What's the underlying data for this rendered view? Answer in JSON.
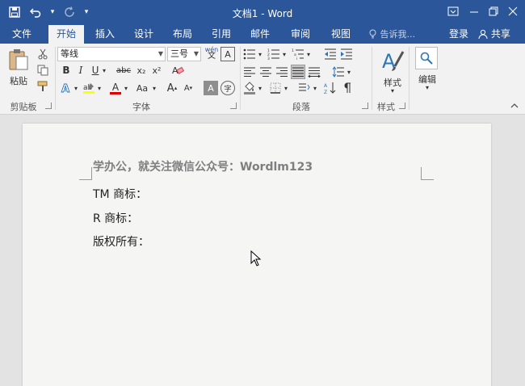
{
  "app": {
    "title": "文档1 - Word"
  },
  "tabs": [
    "文件",
    "开始",
    "插入",
    "设计",
    "布局",
    "引用",
    "邮件",
    "审阅",
    "视图"
  ],
  "tell_me": "告诉我...",
  "login": "登录",
  "share": "共享",
  "ribbon": {
    "paste_label": "粘贴",
    "clipboard_group": "剪贴板",
    "font_group": "字体",
    "paragraph_group": "段落",
    "styles_group": "样式",
    "styles_button": "样式",
    "edit_button": "编辑",
    "font_name": "等线",
    "font_size": "三号",
    "phonetic": "wén",
    "bold": "B",
    "italic": "I",
    "underline": "U",
    "strike": "abc",
    "subscript": "x₂",
    "superscript": "x²",
    "char_a": "A",
    "aa": "Aa",
    "grow": "A",
    "shrink": "A",
    "char_shade": "A",
    "encircle": "字",
    "border_char": "A"
  },
  "document": {
    "lines": [
      "学办公，就关注微信公众号：Wordlm123",
      "TM 商标：",
      "R 商标：",
      "版权所有："
    ]
  },
  "colors": {
    "accent": "#2b579a",
    "ribbon": "#f2f2f2",
    "highlight": "#ffff00",
    "font_color": "#e00000"
  }
}
